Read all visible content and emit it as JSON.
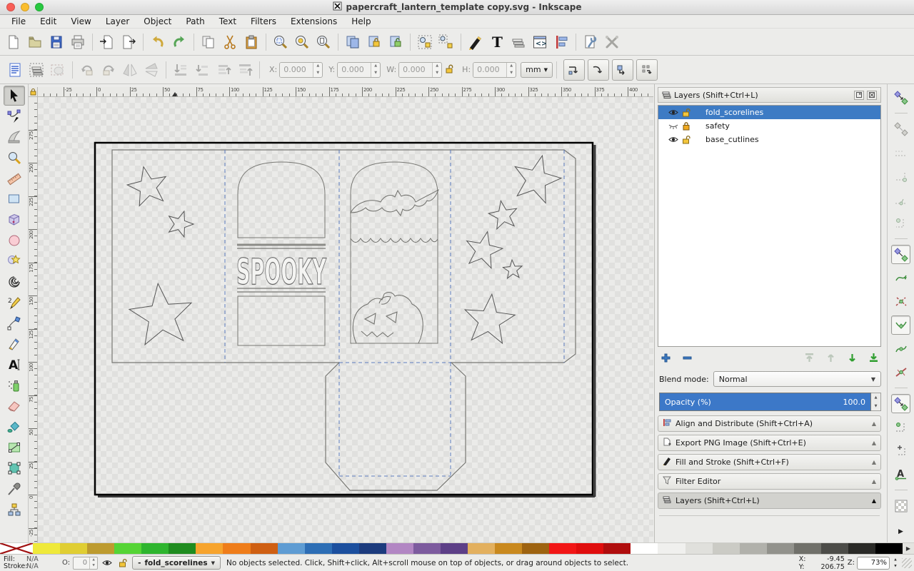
{
  "titlebar": {
    "title": "papercraft_lantern_template copy.svg - Inkscape"
  },
  "menubar": {
    "items": [
      "File",
      "Edit",
      "View",
      "Layer",
      "Object",
      "Path",
      "Text",
      "Filters",
      "Extensions",
      "Help"
    ]
  },
  "tool_controls": {
    "x_label": "X:",
    "x_value": "0.000",
    "y_label": "Y:",
    "y_value": "0.000",
    "w_label": "W:",
    "w_value": "0.000",
    "h_label": "H:",
    "h_value": "0.000",
    "unit_value": "mm"
  },
  "rulers": {
    "horizontal_labels": [
      "-25",
      "0",
      "25",
      "50",
      "75",
      "100",
      "125",
      "150",
      "175",
      "200",
      "225",
      "250",
      "275",
      "300",
      "325",
      "350",
      "375",
      "400"
    ],
    "vertical_labels": [
      "275",
      "250",
      "225",
      "200",
      "175",
      "150",
      "125",
      "100",
      "75",
      "50",
      "25",
      "0",
      "-25"
    ]
  },
  "canvas": {
    "spooky_text": "SPOOKY"
  },
  "layers_panel": {
    "title": "Layers (Shift+Ctrl+L)",
    "layers": [
      {
        "name": "fold_scorelines",
        "visible": true,
        "locked": false,
        "selected": true
      },
      {
        "name": "safety",
        "visible": false,
        "locked": true,
        "selected": false
      },
      {
        "name": "base_cutlines",
        "visible": true,
        "locked": false,
        "selected": false
      }
    ],
    "blend_mode_label": "Blend mode:",
    "blend_mode_value": "Normal",
    "opacity_label": "Opacity (%)",
    "opacity_value": "100.0"
  },
  "docked_panels": [
    {
      "label": "Align and Distribute (Shift+Ctrl+A)",
      "icon": "align-icon",
      "active": false
    },
    {
      "label": "Export PNG Image (Shift+Ctrl+E)",
      "icon": "export-icon",
      "active": false
    },
    {
      "label": "Fill and Stroke (Shift+Ctrl+F)",
      "icon": "fill-stroke-icon",
      "active": false
    },
    {
      "label": "Filter Editor",
      "icon": "filter-icon",
      "active": false
    },
    {
      "label": "Layers (Shift+Ctrl+L)",
      "icon": "layers-icon",
      "active": true
    }
  ],
  "statusbar": {
    "fill_label": "Fill:",
    "fill_value": "N/A",
    "stroke_label": "Stroke:",
    "stroke_value": "N/A",
    "opacity_label": "O:",
    "opacity_value": "0",
    "layer_marker": "-",
    "layer_current": "fold_scorelines",
    "message": "No objects selected. Click, Shift+click, Alt+scroll mouse on top of objects, or drag around objects to select.",
    "x_label": "X:",
    "x_value": "-9.45",
    "y_label": "Y:",
    "y_value": "206.75",
    "z_label": "Z:",
    "zoom_value": "73%"
  },
  "palette": {
    "colors": [
      "#efe93a",
      "#e0ce33",
      "#bd9b2f",
      "#55d435",
      "#2eb52e",
      "#1f8c1f",
      "#f7a42d",
      "#ef7d1a",
      "#cf5f12",
      "#5e9cd3",
      "#2d6eb5",
      "#1b4f9e",
      "#1c3b7d",
      "#b286c3",
      "#7d5b9e",
      "#5d3f87",
      "#e3b05e",
      "#c9891e",
      "#9e6310",
      "#f21616",
      "#e00d0d",
      "#b00d0d",
      "#ffffff",
      "#f0f0ee",
      "#e0e0dc",
      "#cbcbc5",
      "#b1b1ab",
      "#92928c",
      "#70706a",
      "#4c4c48",
      "#2a2a27",
      "#000000"
    ]
  }
}
